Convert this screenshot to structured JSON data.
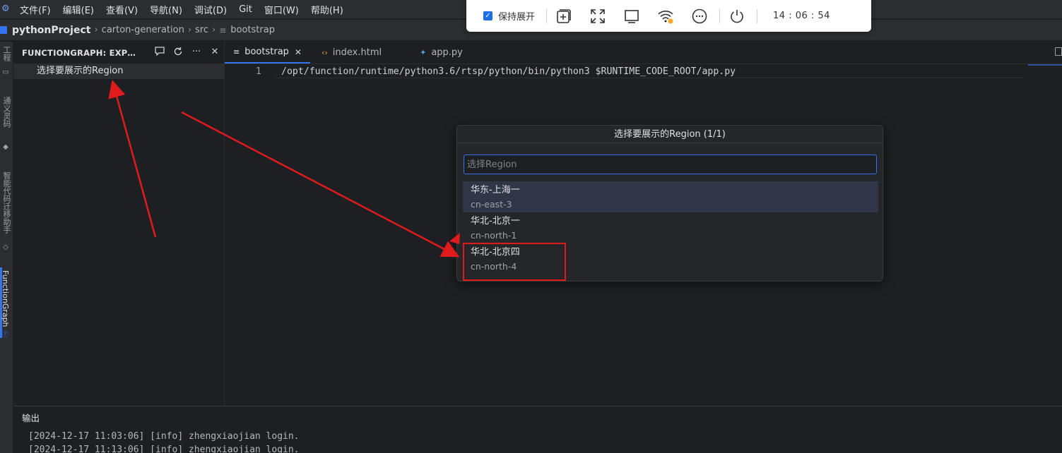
{
  "menubar": {
    "items": [
      "文件(F)",
      "编辑(E)",
      "查看(V)",
      "导航(N)",
      "调试(D)",
      "Git",
      "窗口(W)",
      "帮助(H)"
    ]
  },
  "breadcrumb": {
    "project": "pythonProject",
    "parts": [
      "carton-generation",
      "src"
    ],
    "file": "bootstrap"
  },
  "left_strip": {
    "labels": [
      "工程",
      "通义灵码",
      "智能代码迁移助手",
      "FunctionGraph"
    ]
  },
  "explorer": {
    "title": "FUNCTIONGRAPH: EXPLO···",
    "item": "选择要展示的Region"
  },
  "tabs": [
    {
      "label": "bootstrap",
      "icon": "text-file-icon",
      "active": true
    },
    {
      "label": "index.html",
      "icon": "html-icon",
      "active": false
    },
    {
      "label": "app.py",
      "icon": "python-icon",
      "active": false
    }
  ],
  "editor": {
    "line_number": "1",
    "code": "/opt/function/runtime/python3.6/rtsp/python/bin/python3 $RUNTIME_CODE_ROOT/app.py"
  },
  "popup": {
    "title": "选择要展示的Region (1/1)",
    "placeholder": "选择Region",
    "options": [
      {
        "label": "华东-上海一",
        "desc": "cn-east-3",
        "selected": true
      },
      {
        "label": "华北-北京一",
        "desc": "cn-north-1",
        "selected": false
      },
      {
        "label": "华北-北京四",
        "desc": "cn-north-4",
        "selected": false
      }
    ]
  },
  "output": {
    "title": "输出",
    "lines": [
      "[2024-12-17 11:03:06] [info] zhengxiaojian login.",
      "[2024-12-17 11:13:06] [info] zhengxiaojian login."
    ]
  },
  "toolbar": {
    "keep_label": "保持展开",
    "time": "14 : 06 : 54",
    "icons": [
      "add-window-icon",
      "fullscreen-icon",
      "monitor-icon",
      "wifi-icon",
      "more-icon",
      "power-icon"
    ]
  },
  "colors": {
    "accent": "#3574f0",
    "annotation": "#e01b1b",
    "background": "#1e1f22",
    "panel": "#2b2d30"
  }
}
